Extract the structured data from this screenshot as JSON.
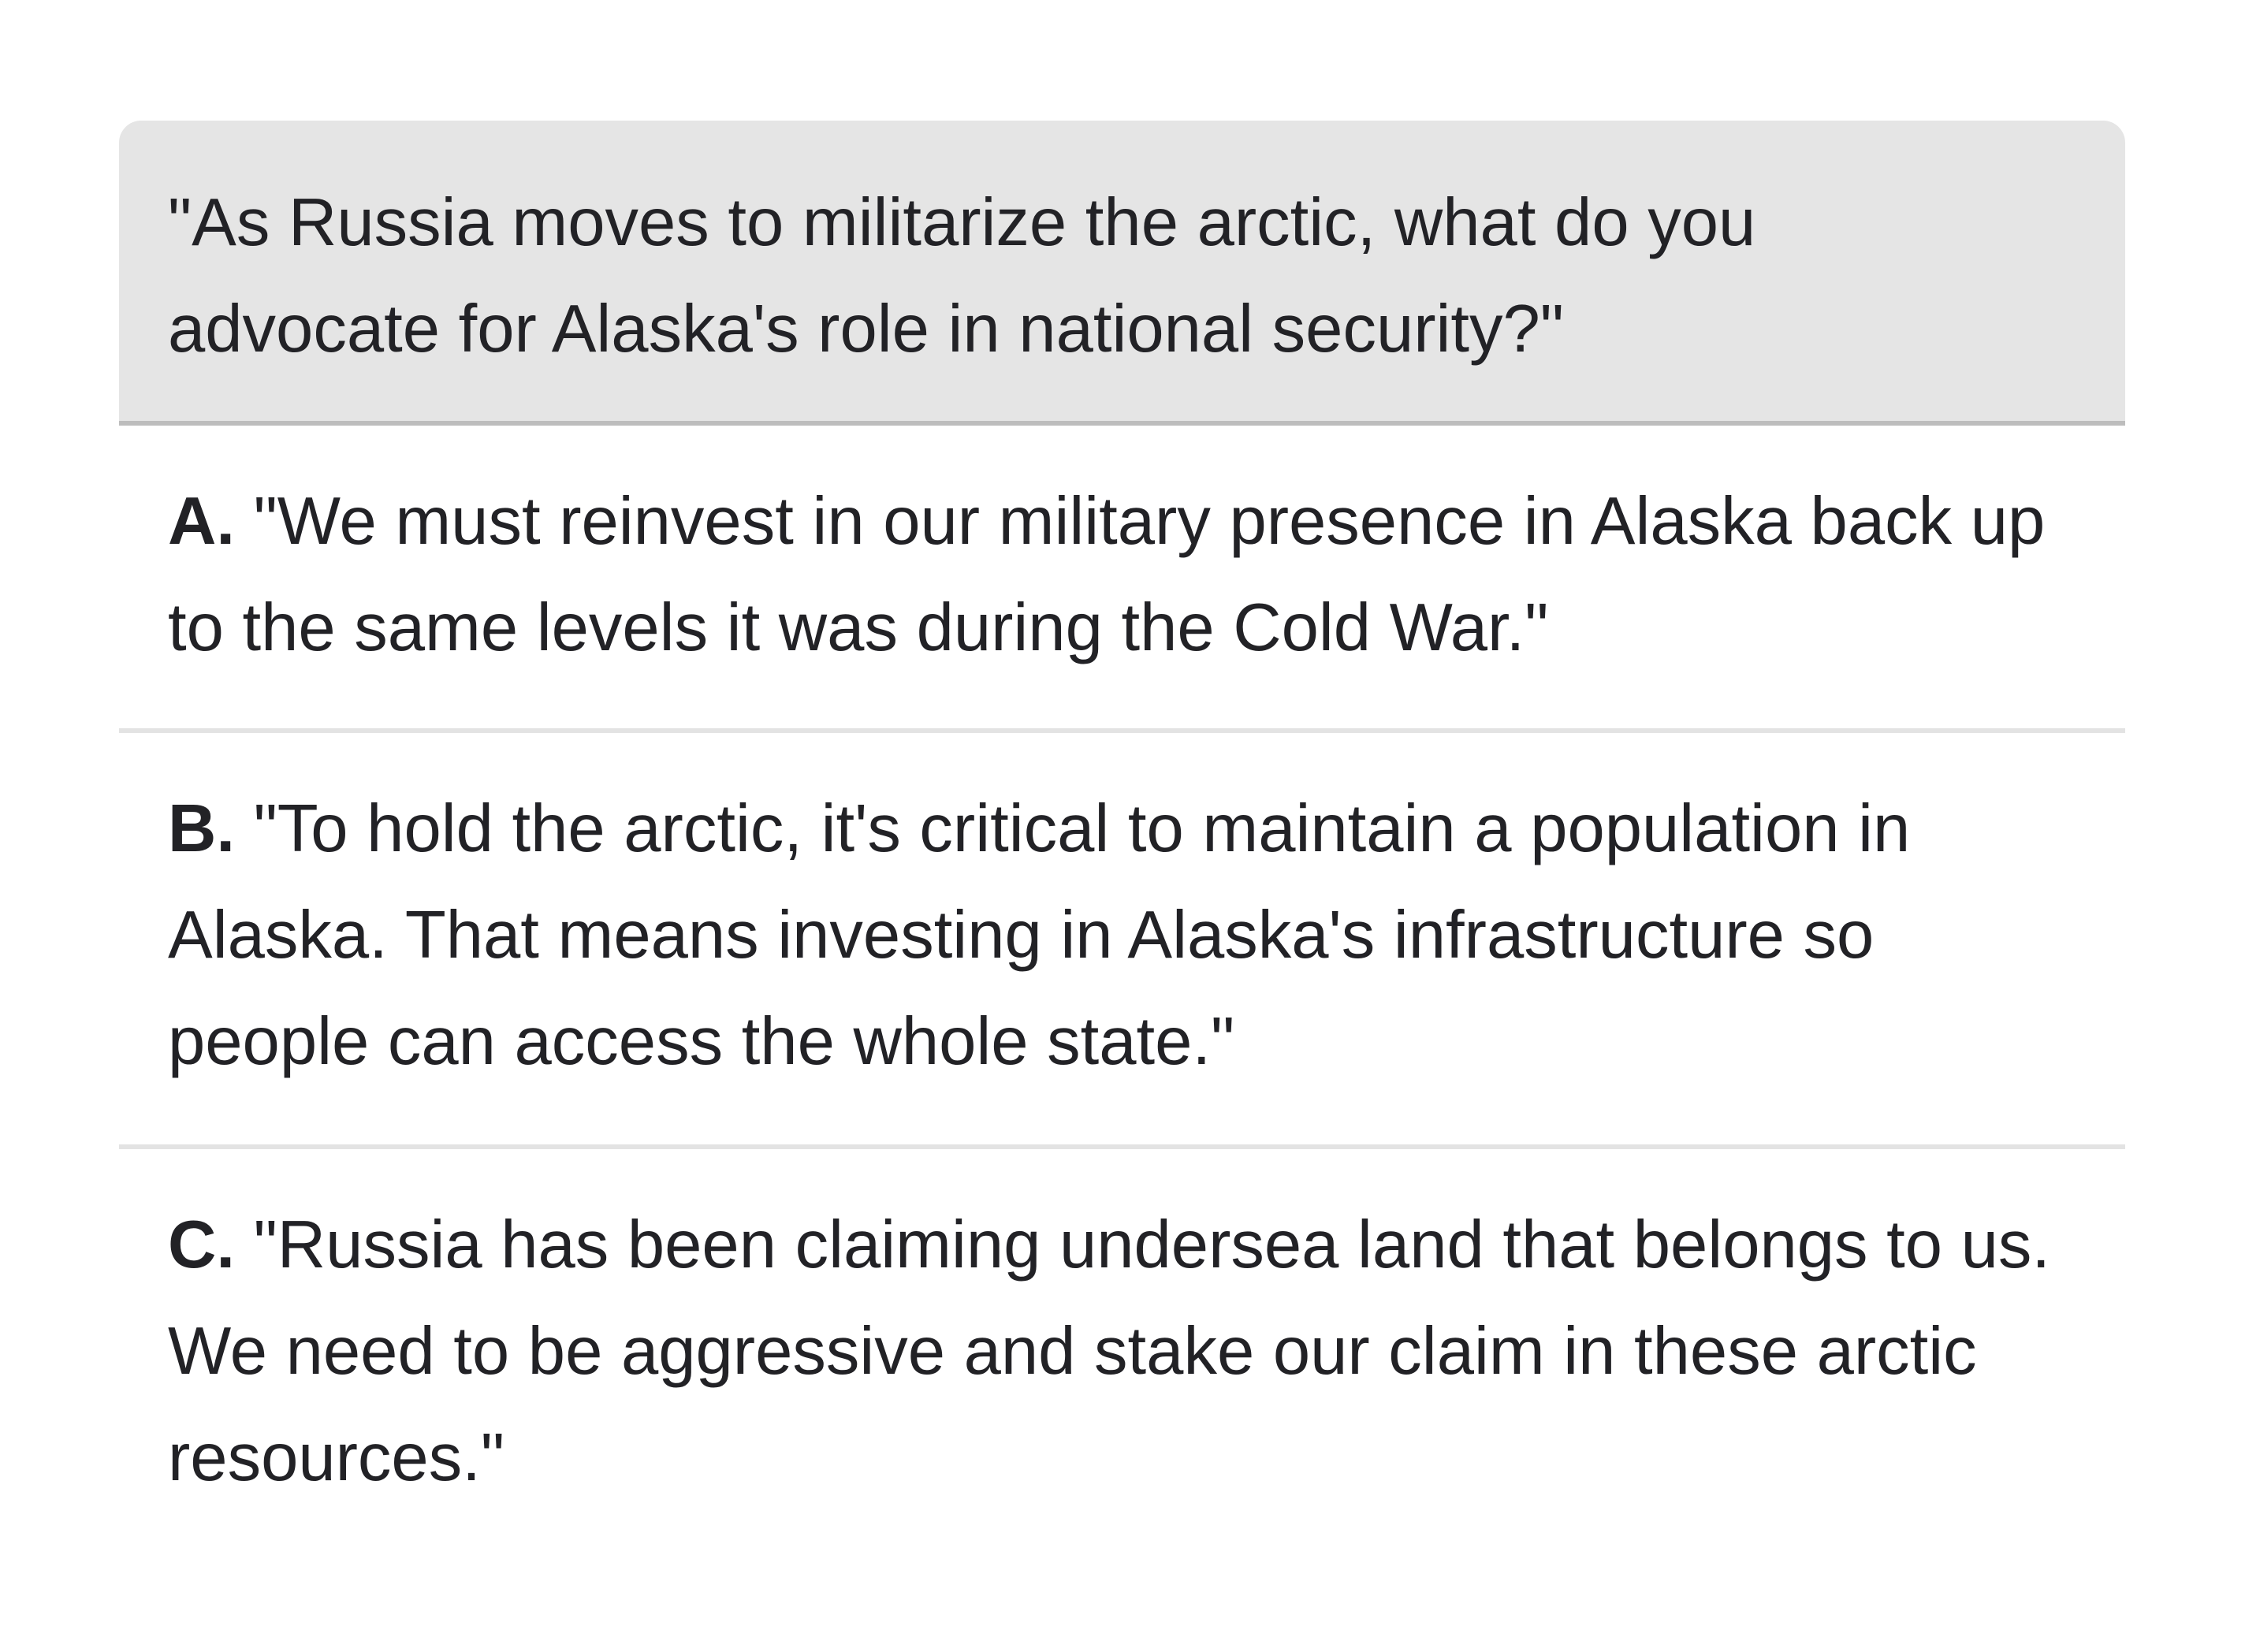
{
  "question": {
    "text": "\"As Russia moves to militarize the arctic, what do you advocate for Alaska's role in national security?\""
  },
  "options": [
    {
      "letter": "A.",
      "text": "\"We must reinvest in our military presence in Alaska back up to the same levels it was during the Cold War.\""
    },
    {
      "letter": "B.",
      "text": "\"To hold the arctic, it's critical to maintain a population in Alaska. That means investing in Alaska's infrastructure so people can access the whole state.\""
    },
    {
      "letter": "C.",
      "text": "\"Russia has been claiming undersea land that belongs to us. We need to be aggressive and stake our claim in these arctic resources.\""
    }
  ],
  "colors": {
    "question_background": "#e5e5e5",
    "question_divider": "#bdbdbd",
    "option_divider": "#e3e3e3",
    "text": "#222226"
  }
}
